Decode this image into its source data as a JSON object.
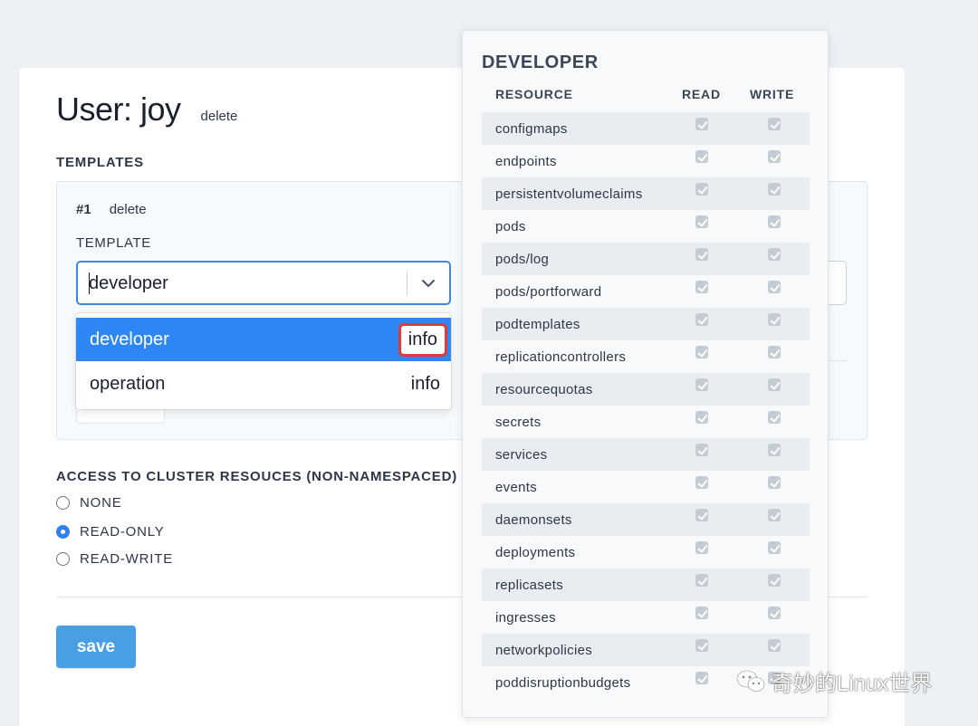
{
  "user": {
    "title": "User: joy",
    "delete_label": "delete"
  },
  "templates": {
    "section_label": "TEMPLATES",
    "item_number": "#1",
    "item_delete_label": "delete",
    "field_label": "TEMPLATE",
    "select_value": "developer",
    "options": [
      {
        "label": "developer",
        "info": "info",
        "selected": true
      },
      {
        "label": "operation",
        "info": "info",
        "selected": false
      }
    ]
  },
  "cluster_access": {
    "label": "ACCESS TO CLUSTER RESOUCES (NON-NAMESPACED)",
    "options": [
      {
        "label": "NONE",
        "checked": false
      },
      {
        "label": "READ-ONLY",
        "checked": true
      },
      {
        "label": "READ-WRITE",
        "checked": false
      }
    ]
  },
  "save_label": "save",
  "popover": {
    "title": "DEVELOPER",
    "columns": {
      "resource": "RESOURCE",
      "read": "READ",
      "write": "WRITE"
    },
    "rows": [
      {
        "resource": "configmaps",
        "read": true,
        "write": true
      },
      {
        "resource": "endpoints",
        "read": true,
        "write": true
      },
      {
        "resource": "persistentvolumeclaims",
        "read": true,
        "write": true
      },
      {
        "resource": "pods",
        "read": true,
        "write": true
      },
      {
        "resource": "pods/log",
        "read": true,
        "write": true
      },
      {
        "resource": "pods/portforward",
        "read": true,
        "write": true
      },
      {
        "resource": "podtemplates",
        "read": true,
        "write": true
      },
      {
        "resource": "replicationcontrollers",
        "read": true,
        "write": true
      },
      {
        "resource": "resourcequotas",
        "read": true,
        "write": true
      },
      {
        "resource": "secrets",
        "read": true,
        "write": true
      },
      {
        "resource": "services",
        "read": true,
        "write": true
      },
      {
        "resource": "events",
        "read": true,
        "write": true
      },
      {
        "resource": "daemonsets",
        "read": true,
        "write": true
      },
      {
        "resource": "deployments",
        "read": true,
        "write": true
      },
      {
        "resource": "replicasets",
        "read": true,
        "write": true
      },
      {
        "resource": "ingresses",
        "read": true,
        "write": true
      },
      {
        "resource": "networkpolicies",
        "read": true,
        "write": true
      },
      {
        "resource": "poddisruptionbudgets",
        "read": true,
        "write": true
      }
    ]
  },
  "watermark": {
    "text": "奇妙的Linux世界",
    "icon": "wechat-icon"
  },
  "colors": {
    "accent": "#2f86f6",
    "save_button": "#4a9fe3",
    "highlight_border": "#e53935",
    "page_bg": "#edf1f5"
  }
}
